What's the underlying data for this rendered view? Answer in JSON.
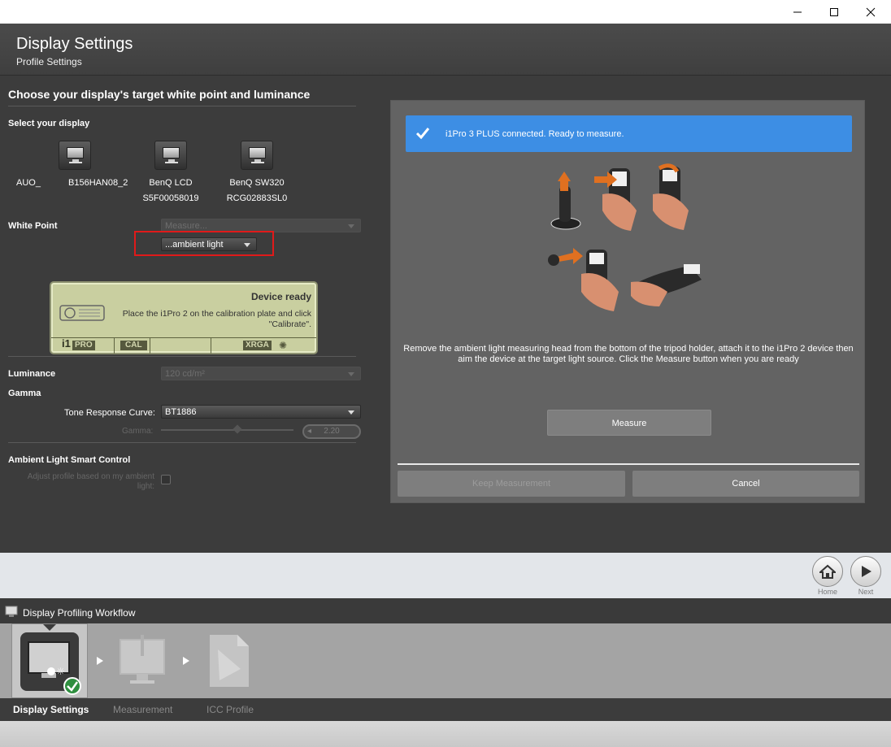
{
  "window": {
    "minimize_icon": "minimize-icon",
    "maximize_icon": "maximize-icon",
    "close_icon": "close-icon"
  },
  "header": {
    "title": "Display Settings",
    "subtitle": "Profile Settings"
  },
  "left": {
    "section_title": "Choose your display's target white point and luminance",
    "select_display_label": "Select your display",
    "displays": [
      {
        "line1": "AUO_",
        "line1b": "B156HAN08_2",
        "line2": ""
      },
      {
        "line1": "BenQ LCD",
        "line2": "S5F00058019"
      },
      {
        "line1": "BenQ SW320",
        "line2": "RCG02883SL0"
      }
    ],
    "white_point_label": "White Point",
    "white_point_value": "Measure...",
    "white_point_sub": "...ambient light",
    "lcd": {
      "title": "Device ready",
      "message": "Place the i1Pro 2 on the calibration plate and click \"Calibrate\".",
      "seg_brand": "i1",
      "seg_pro": "PRO",
      "seg_cal": "CAL",
      "seg_xrga": "XRGA"
    },
    "luminance_label": "Luminance",
    "luminance_value": "120 cd/m²",
    "gamma_label": "Gamma",
    "trc_label": "Tone Response Curve:",
    "trc_value": "BT1886",
    "gamma_sub_label": "Gamma:",
    "gamma_value": "2.20",
    "alsc_label": "Ambient Light Smart Control",
    "adjust_label": "Adjust profile based on my ambient light:"
  },
  "panel": {
    "banner_text": "i1Pro 3 PLUS connected. Ready to measure.",
    "description_line1": "Remove the ambient light measuring head from the bottom of the tripod holder, attach it to the i1Pro 2 device then",
    "description_line2": "aim the device at the target light source. Click the Measure button when you are ready",
    "measure_button": "Measure",
    "keep_button": "Keep Measurement",
    "cancel_button": "Cancel"
  },
  "nav": {
    "home_label": "Home",
    "next_label": "Next"
  },
  "workflow": {
    "title": "Display Profiling Workflow",
    "steps": [
      "Display Settings",
      "Measurement",
      "ICC Profile"
    ]
  },
  "colors": {
    "accent": "#3d8ee4",
    "highlight": "#e01a1a"
  }
}
